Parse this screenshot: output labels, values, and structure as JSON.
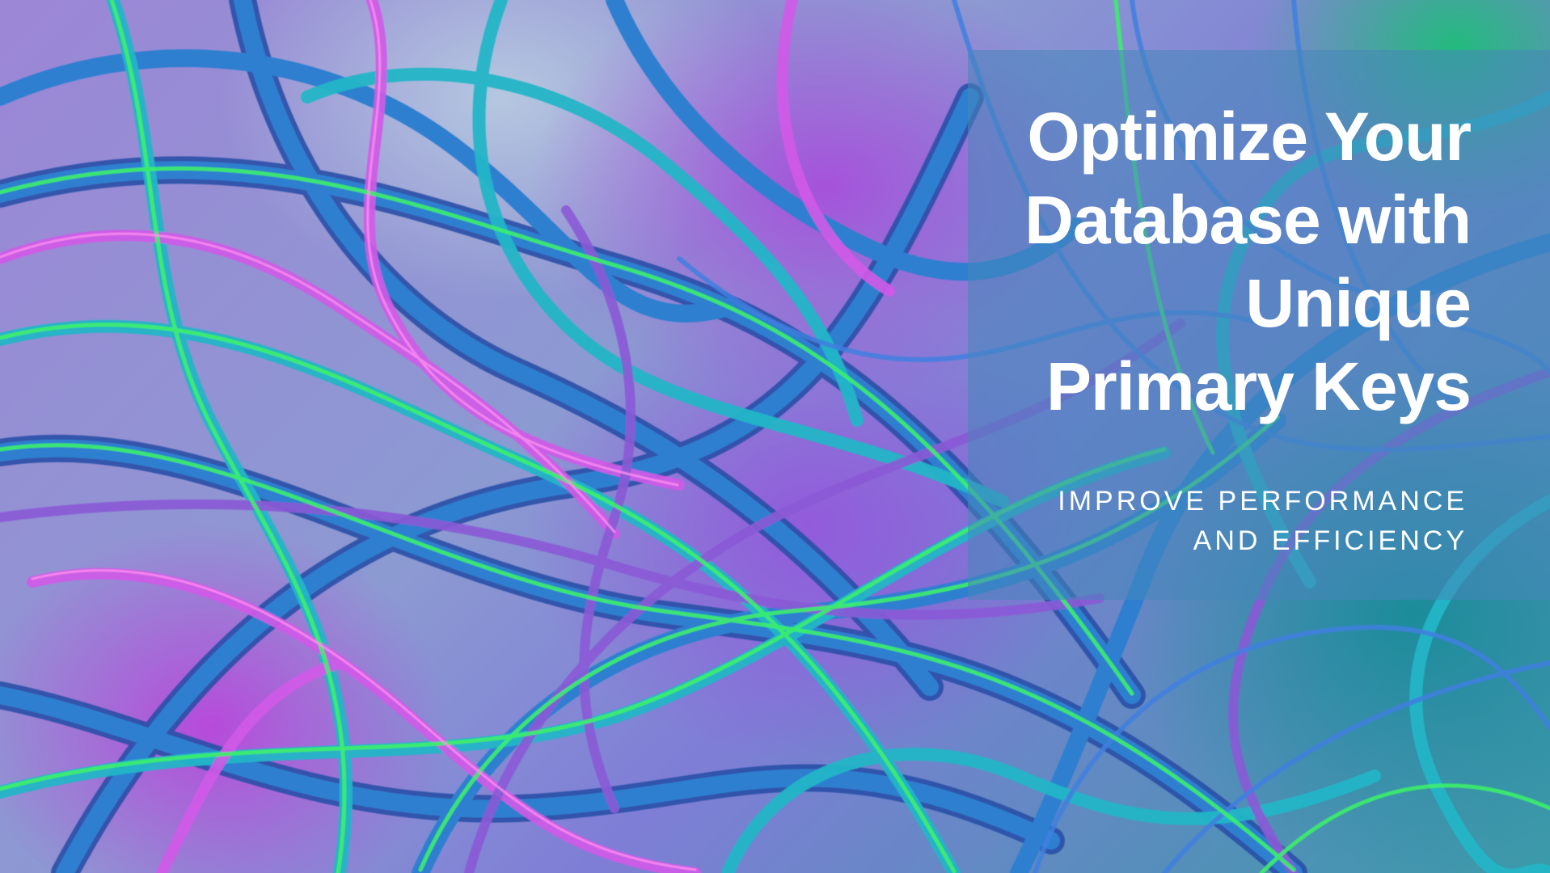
{
  "slide": {
    "title_lines": [
      "Optimize Your",
      "Database with",
      "Unique",
      "Primary Keys"
    ],
    "subtitle_lines": [
      "IMPROVE PERFORMANCE",
      "AND EFFICIENCY"
    ]
  },
  "background": {
    "description_icon": "tangled-tubes-image",
    "colors": {
      "tube_blue": "#2f7fd0",
      "tube_teal": "#22b6c8",
      "tube_green": "#3cf06a",
      "tube_magenta": "#d25ae8",
      "tube_purple": "#8a5ad6",
      "panel_overlay": "#4687b9",
      "text": "#ffffff"
    }
  }
}
